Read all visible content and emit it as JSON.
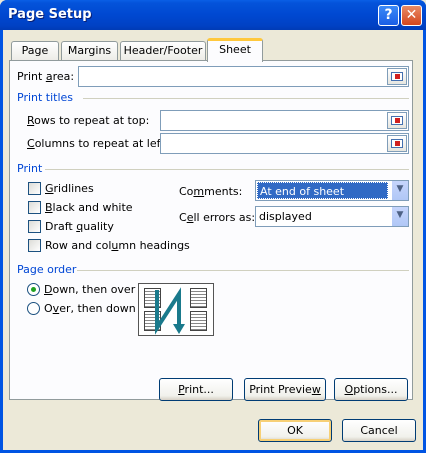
{
  "window": {
    "title": "Page Setup"
  },
  "titlebar": {
    "help_label": "?",
    "close_label": "✕"
  },
  "tabs": [
    {
      "label": "Page"
    },
    {
      "label": "Margins"
    },
    {
      "label": "Header/Footer"
    },
    {
      "label": "Sheet"
    }
  ],
  "print_area": {
    "label_pre": "Print ",
    "label_u": "a",
    "label_post": "rea:",
    "value": ""
  },
  "print_titles": {
    "heading": "Print titles",
    "rows_label_u": "R",
    "rows_label_post": "ows to repeat at top:",
    "rows_value": "",
    "cols_label_u": "C",
    "cols_label_post": "olumns to repeat at left:",
    "cols_value": ""
  },
  "print": {
    "heading": "Print",
    "gridlines": {
      "u": "G",
      "rest": "ridlines",
      "checked": false
    },
    "black_white": {
      "u": "B",
      "rest": "lack and white",
      "checked": false
    },
    "draft": {
      "pre": "Draft ",
      "u": "q",
      "rest": "uality",
      "checked": false
    },
    "row_col": {
      "pre": "Row and col",
      "u": "u",
      "rest": "mn headings",
      "checked": false
    },
    "comments_pre": "Co",
    "comments_u": "m",
    "comments_post": "ments:",
    "comments_value": "At end of sheet",
    "errors_pre": "C",
    "errors_u": "e",
    "errors_post": "ll errors as:",
    "errors_value": "displayed"
  },
  "page_order": {
    "heading": "Page order",
    "down_over": {
      "u": "D",
      "rest": "own, then over",
      "selected": true
    },
    "over_down": {
      "pre": "O",
      "u": "v",
      "rest": "er, then down",
      "selected": false
    }
  },
  "buttons": {
    "print_u": "P",
    "print_rest": "rint...",
    "preview_pre": "Print Previe",
    "preview_u": "w",
    "preview_rest": "",
    "options_u": "O",
    "options_rest": "ptions...",
    "ok": "OK",
    "cancel": "Cancel"
  },
  "colors": {
    "section_heading": "#0046d5",
    "titlebar": "#0054e3",
    "selection": "#316ac5",
    "radio_dot": "#21a121"
  }
}
